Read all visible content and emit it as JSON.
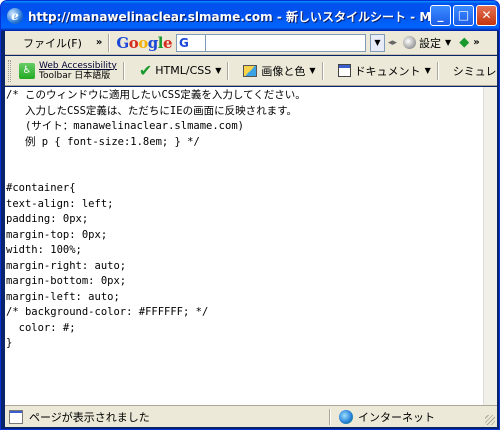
{
  "window": {
    "title": "http://manawelinaclear.slmame.com - 新しいスタイルシート - M...",
    "controls": {
      "minimize": "_",
      "maximize": "□",
      "close": "✕"
    }
  },
  "menubar": {
    "file_label": "ファイル(F)",
    "more": "»"
  },
  "google_toolbar": {
    "logo_letters": [
      "G",
      "o",
      "o",
      "g",
      "l",
      "e"
    ],
    "search_field_label": "G",
    "search_value": "",
    "settings_label": "設定",
    "more": "»"
  },
  "accessibility_toolbar": {
    "logo_line1": "Web Accessibility",
    "logo_line2": "Toolbar",
    "logo_line3": "日本語版",
    "items": [
      {
        "label": "HTML/CSS",
        "icon": "check-icon"
      },
      {
        "label": "画像と色",
        "icon": "image-icon"
      },
      {
        "label": "ドキュメント",
        "icon": "document-icon"
      },
      {
        "label": "シミュレ",
        "icon": ""
      }
    ]
  },
  "editor": {
    "content": "/* このウィンドウに適用したいCSS定義を入力してください。\n   入力したCSS定義は、ただちにIEの画面に反映されます。\n   (サイト：manawelinaclear.slmame.com)\n   例 p { font-size:1.8em; } */\n\n\n#container{\ntext-align: left;\npadding: 0px;\nmargin-top: 0px;\nwidth: 100%;\nmargin-right: auto;\nmargin-bottom: 0px;\nmargin-left: auto;\n/* background-color: #FFFFFF; */\n  color: #;\n}"
  },
  "statusbar": {
    "status_text": "ページが表示されました",
    "zone_text": "インターネット"
  }
}
